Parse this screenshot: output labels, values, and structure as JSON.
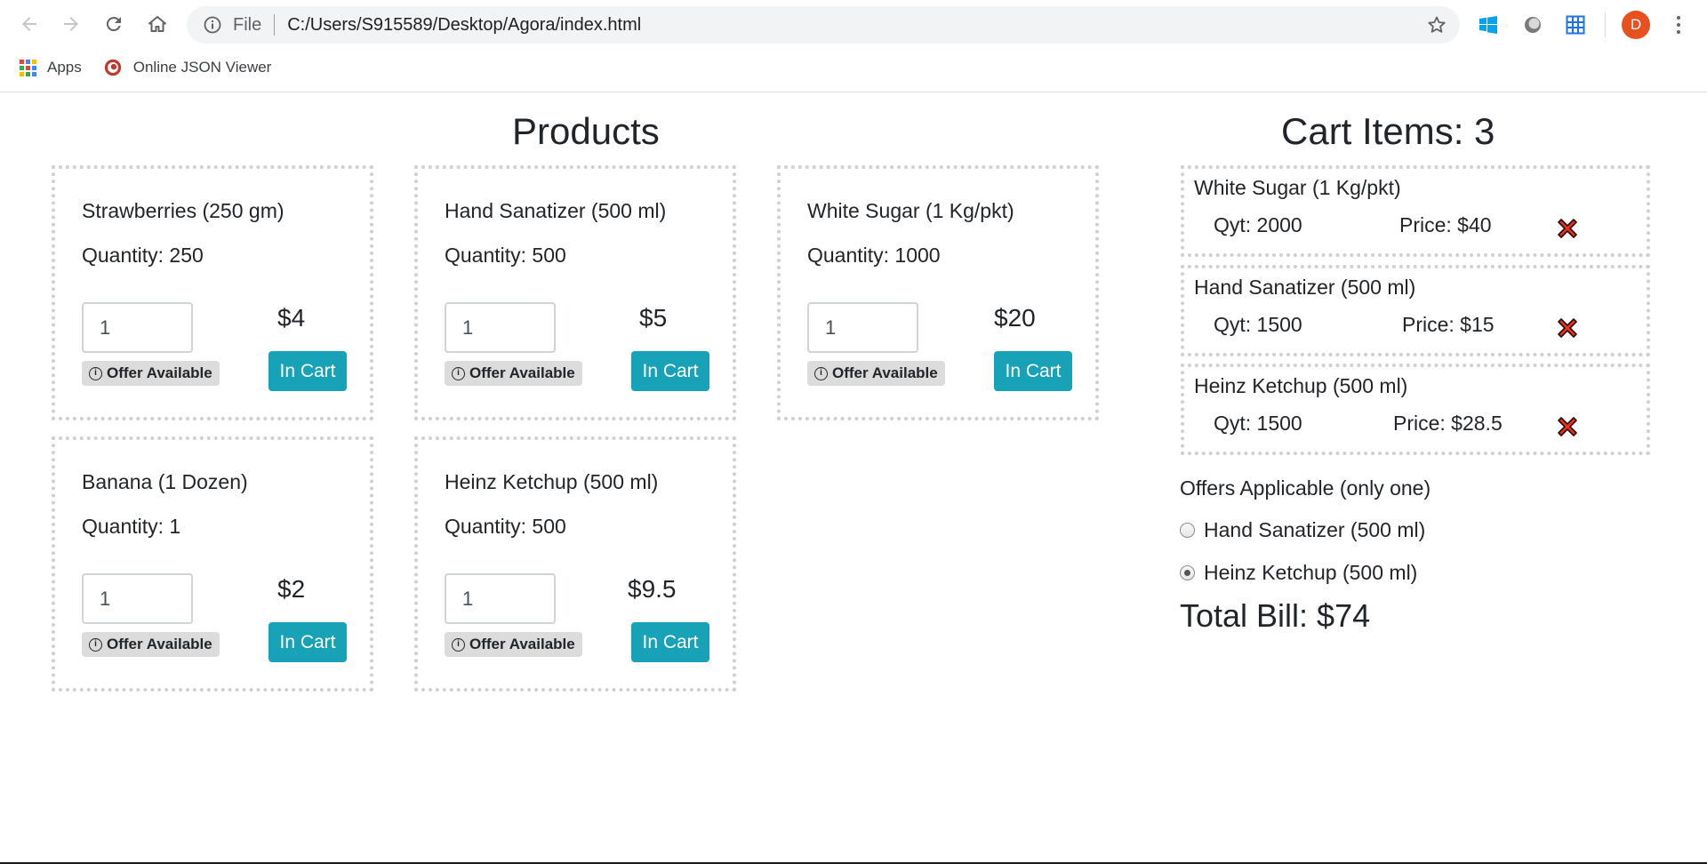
{
  "browser": {
    "scheme": "File",
    "url": "C:/Users/S915589/Desktop/Agora/index.html",
    "profile_initial": "D",
    "bookmarks": [
      {
        "label": "Apps",
        "icon": "apps-grid-icon"
      },
      {
        "label": "Online JSON Viewer",
        "icon": "json-viewer-icon"
      }
    ]
  },
  "products": {
    "title": "Products",
    "items": [
      {
        "name": "Strawberries (250 gm)",
        "quantity": "Quantity: 250",
        "input_value": "1",
        "price": "$4",
        "offer": "Offer Available",
        "button": "In Cart"
      },
      {
        "name": "Hand Sanatizer (500 ml)",
        "quantity": "Quantity: 500",
        "input_value": "1",
        "price": "$5",
        "offer": "Offer Available",
        "button": "In Cart"
      },
      {
        "name": "White Sugar (1 Kg/pkt)",
        "quantity": "Quantity: 1000",
        "input_value": "1",
        "price": "$20",
        "offer": "Offer Available",
        "button": "In Cart"
      },
      {
        "name": "Banana (1 Dozen)",
        "quantity": "Quantity: 1",
        "input_value": "1",
        "price": "$2",
        "offer": "Offer Available",
        "button": "In Cart"
      },
      {
        "name": "Heinz Ketchup (500 ml)",
        "quantity": "Quantity: 500",
        "input_value": "1",
        "price": "$9.5",
        "offer": "Offer Available",
        "button": "In Cart"
      }
    ]
  },
  "cart": {
    "title": "Cart Items: 3",
    "items": [
      {
        "name": "White Sugar (1 Kg/pkt)",
        "qty": "Qyt: 2000",
        "price": "Price: $40"
      },
      {
        "name": "Hand Sanatizer (500 ml)",
        "qty": "Qyt: 1500",
        "price": "Price: $15"
      },
      {
        "name": "Heinz Ketchup (500 ml)",
        "qty": "Qyt: 1500",
        "price": "Price: $28.5"
      }
    ],
    "offers_title": "Offers Applicable (only one)",
    "offers": [
      {
        "label": "Hand Sanatizer (500 ml)",
        "selected": false
      },
      {
        "label": "Heinz Ketchup (500 ml)",
        "selected": true
      }
    ],
    "total": "Total Bill: $74"
  },
  "colors": {
    "accent": "#17a2b8",
    "remove": "#e8321f",
    "badge": "#dcdcdc"
  }
}
